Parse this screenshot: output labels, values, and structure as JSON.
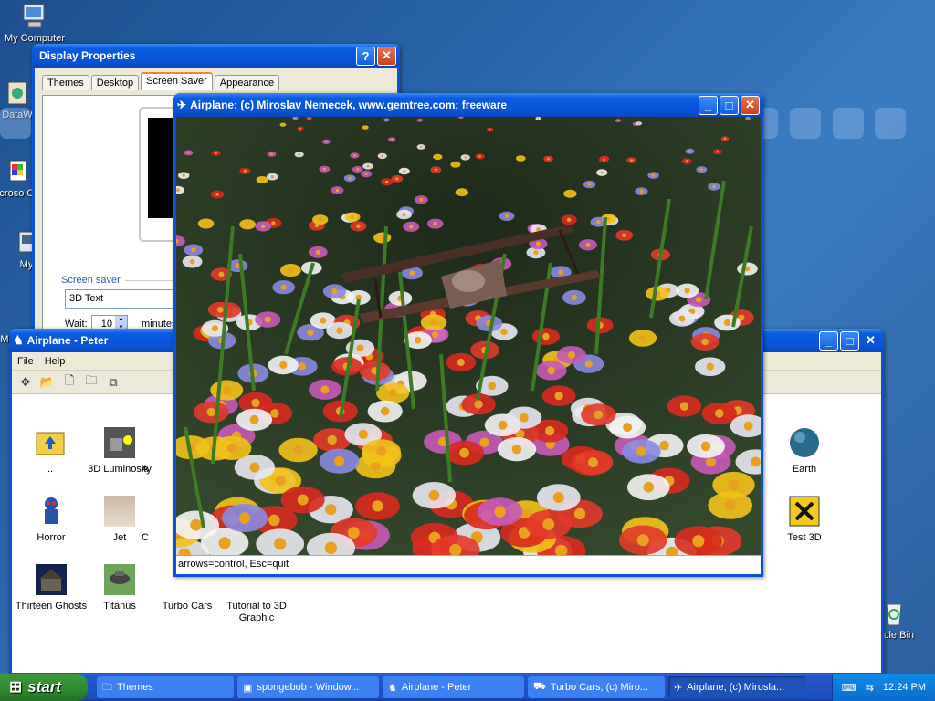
{
  "desktop": {
    "icons": [
      {
        "label": "My Computer"
      },
      {
        "label": "DataW"
      },
      {
        "label": "Microso C++"
      },
      {
        "label": "My"
      },
      {
        "label": "M"
      },
      {
        "label": "cycle Bin"
      }
    ]
  },
  "display_properties": {
    "title": "Display Properties",
    "help_btn": "?",
    "close_btn": "✕",
    "tabs": [
      "Themes",
      "Desktop",
      "Screen Saver",
      "Appearance"
    ],
    "screen_saver_label": "Screen saver",
    "screen_saver_value": "3D Text",
    "wait_label": "Wait:",
    "wait_value": "10",
    "minutes_label": "minutes"
  },
  "explorer": {
    "title": "Airplane - Peter",
    "menu": [
      "File",
      "Help"
    ],
    "files": [
      {
        "label": ".."
      },
      {
        "label": "3D Luminosity"
      },
      {
        "label": "A"
      },
      {
        "label": "Earth"
      },
      {
        "label": "Horror"
      },
      {
        "label": "Jet"
      },
      {
        "label": "C"
      },
      {
        "label": "Test 3D"
      },
      {
        "label": "Thirteen Ghosts"
      },
      {
        "label": "Titanus"
      },
      {
        "label": "Turbo Cars"
      },
      {
        "label": "Tutorial to 3D Graphic"
      }
    ]
  },
  "game": {
    "title": "Airplane;   (c) Miroslav Nemecek, www.gemtree.com;   freeware",
    "status": "arrows=control, Esc=quit"
  },
  "taskbar": {
    "start_label": "start",
    "tasks": [
      "Themes",
      "spongebob - Window...",
      "Airplane - Peter",
      "Turbo Cars;   (c) Miro...",
      "Airplane;   (c) Mirosla..."
    ],
    "clock": "12:24 PM"
  },
  "colors": {
    "titlebar": "#0a5de0",
    "start": "#2e8b2e",
    "desktop": "#2a66aa"
  }
}
